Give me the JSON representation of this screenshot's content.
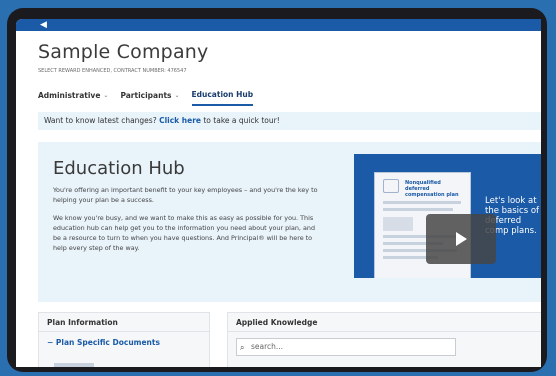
{
  "header": {
    "company": "Sample Company",
    "contract_line": "SELECT REWARD ENHANCED, Contract Number: 476547"
  },
  "nav": {
    "items": [
      {
        "label": "Administrative",
        "has_menu": true
      },
      {
        "label": "Participants",
        "has_menu": true
      },
      {
        "label": "Education Hub",
        "active": true
      }
    ]
  },
  "banner": {
    "prefix": "Want to know latest changes? ",
    "link": "Click here",
    "suffix": " to take a quick tour!"
  },
  "education_hub": {
    "title": "Education Hub",
    "para1": "You're offering an important benefit to your key employees – and you're the key to helping your plan be a success.",
    "para2": "We know you're busy, and we want to make this as easy as possible for you. This education hub can help get you to the information you need about your plan, and be a resource to turn to when you have questions. And Principal® will be here to help every step of the way.",
    "video": {
      "doc_title": "Nonqualified deferred compensation plan",
      "overlay_text": "Let's look at the basics of deferred comp plans."
    }
  },
  "plan_information": {
    "heading": "Plan Information",
    "link": "Plan Specific Documents",
    "link_prefix_symbol": "−"
  },
  "applied_knowledge": {
    "heading": "Applied Knowledge",
    "search_placeholder": "search..."
  },
  "colors": {
    "brand_blue": "#1a5aa6",
    "light_blue_bg": "#e8f3fa"
  }
}
